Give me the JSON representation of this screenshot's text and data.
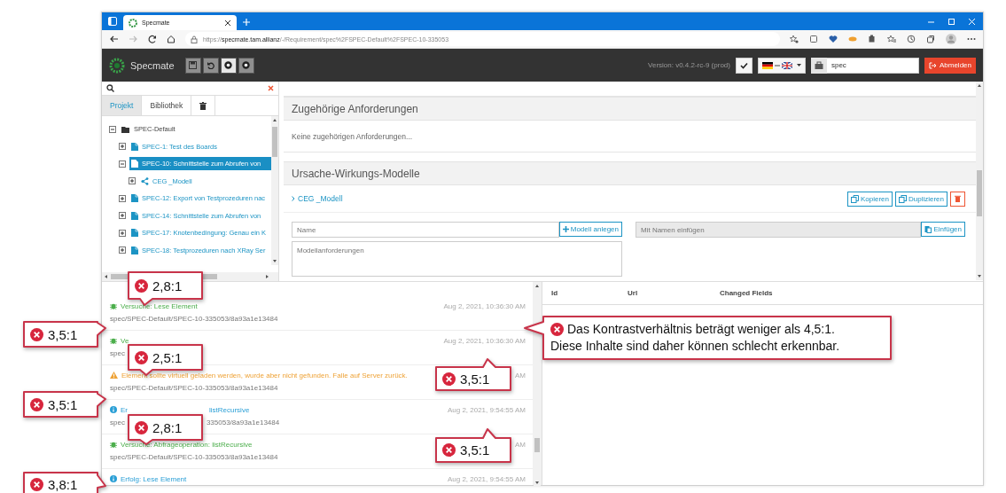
{
  "browser": {
    "tab_title": "Specmate",
    "url_scheme": "https://",
    "url_host": "specmate.tam.allianz",
    "url_path": "/-/Requirement/spec%2FSPEC-Default%2FSPEC-10-335053"
  },
  "header": {
    "app_name": "Specmate",
    "toolbar": [
      {
        "kind": "save",
        "disabled": true
      },
      {
        "kind": "undo",
        "disabled": true
      },
      {
        "kind": "dot",
        "disabled": false
      },
      {
        "kind": "dot",
        "disabled": true
      }
    ],
    "version": "Version: v0.4.2-rc-9 (prod)",
    "search_value": "spec",
    "logout_label": "Abmelden"
  },
  "sidebar": {
    "tabs": [
      {
        "kind": "text",
        "label": "Projekt",
        "selected": true
      },
      {
        "kind": "text",
        "label": "Bibliothek",
        "selected": false
      },
      {
        "kind": "trash",
        "selected": false
      }
    ],
    "tree": [
      {
        "label": "SPEC-Default",
        "kind": "folder",
        "expanded": true,
        "selected": false,
        "children": [
          {
            "label": "SPEC-1: Test des Boards",
            "kind": "requirement",
            "expanded": false,
            "selected": false
          },
          {
            "label": "SPEC-10: Schnittstelle zum Abrufen von",
            "kind": "requirement",
            "expanded": true,
            "selected": true,
            "children": [
              {
                "label": "CEG _Modell",
                "kind": "model",
                "expanded": false,
                "selected": false
              }
            ]
          },
          {
            "label": "SPEC-12: Export von Testprozeduren nac",
            "kind": "requirement",
            "expanded": false,
            "selected": false
          },
          {
            "label": "SPEC-14: Schnittstelle zum Abrufen von",
            "kind": "requirement",
            "expanded": false,
            "selected": false
          },
          {
            "label": "SPEC-17: Knotenbedingung: Genau ein K",
            "kind": "requirement",
            "expanded": false,
            "selected": false
          },
          {
            "label": "SPEC-18: Testprozeduren nach XRay Ser",
            "kind": "requirement",
            "expanded": false,
            "selected": false
          }
        ]
      }
    ]
  },
  "detail": {
    "sections": [
      {
        "kind": "related",
        "title": "Zugehörige Anforderungen",
        "text": "Keine zugehörigen Anforderungen..."
      },
      {
        "kind": "models",
        "title": "Ursache-Wirkungs-Modelle",
        "models": [
          {
            "name": "CEG _Modell"
          }
        ],
        "copy_label": "Kopieren",
        "duplicate_label": "Duplizieren",
        "name_placeholder": "Name",
        "create_label": "Modell anlegen",
        "paste_placeholder": "Mit Namen einfügen",
        "paste_disabled": true,
        "paste_label": "Einfügen",
        "description_placeholder": "Modellanforderungen"
      }
    ]
  },
  "log": {
    "entries": [
      {
        "kind": "attempt",
        "title_parts": [
          "Versuche: Lese Element"
        ],
        "time": "Aug 2, 2021, 10:36:30 AM",
        "path_parts": [
          "spec/SPEC-Default/SPEC-10-335053/8a93a1e13484"
        ]
      },
      {
        "kind": "attempt",
        "title_parts": [
          "Ve"
        ],
        "time": "Aug 2, 2021, 10:36:30 AM",
        "path_parts": [
          "spec"
        ]
      },
      {
        "kind": "warning",
        "title_parts": [
          "Element sollte virtuell geladen werden, wurde aber nicht gefunden. Falle auf Server zurück."
        ],
        "time": "AM",
        "path_parts": [
          "spec/SPEC-Default/SPEC-10-335053/8a93a1e13484"
        ]
      },
      {
        "kind": "info",
        "title_parts": [
          "Er",
          "listRecursive"
        ],
        "time": "Aug 2, 2021, 9:54:55 AM",
        "path_parts": [
          "spec",
          "335053/8a93a1e13484"
        ]
      },
      {
        "kind": "attempt",
        "title_parts": [
          "Versuche: Abfrageoperation: listRecursive"
        ],
        "time": "AM",
        "path_parts": [
          "spec/SPEC-Default/SPEC-10-335053/8a93a1e13484"
        ]
      },
      {
        "kind": "info",
        "title_parts": [
          "Erfolg: Lese Element"
        ],
        "time": "Aug 2, 2021, 9:54:55 AM"
      }
    ]
  },
  "changes": {
    "columns": [
      "Id",
      "Url",
      "Changed Fields"
    ]
  },
  "annotations": [
    {
      "lines": [
        "2,8:1"
      ]
    },
    {
      "lines": [
        "3,5:1"
      ]
    },
    {
      "lines": [
        "Das Kontrastverhältnis beträgt weniger als 4,5:1.",
        "Diese Inhalte sind daher können schlecht erkennbar."
      ]
    },
    {
      "lines": [
        "2,5:1"
      ]
    },
    {
      "lines": [
        "3,5:1"
      ]
    },
    {
      "lines": [
        "3,5:1"
      ]
    },
    {
      "lines": [
        "2,8:1"
      ]
    },
    {
      "lines": [
        "3,5:1"
      ]
    },
    {
      "lines": [
        "3,8:1"
      ]
    }
  ]
}
